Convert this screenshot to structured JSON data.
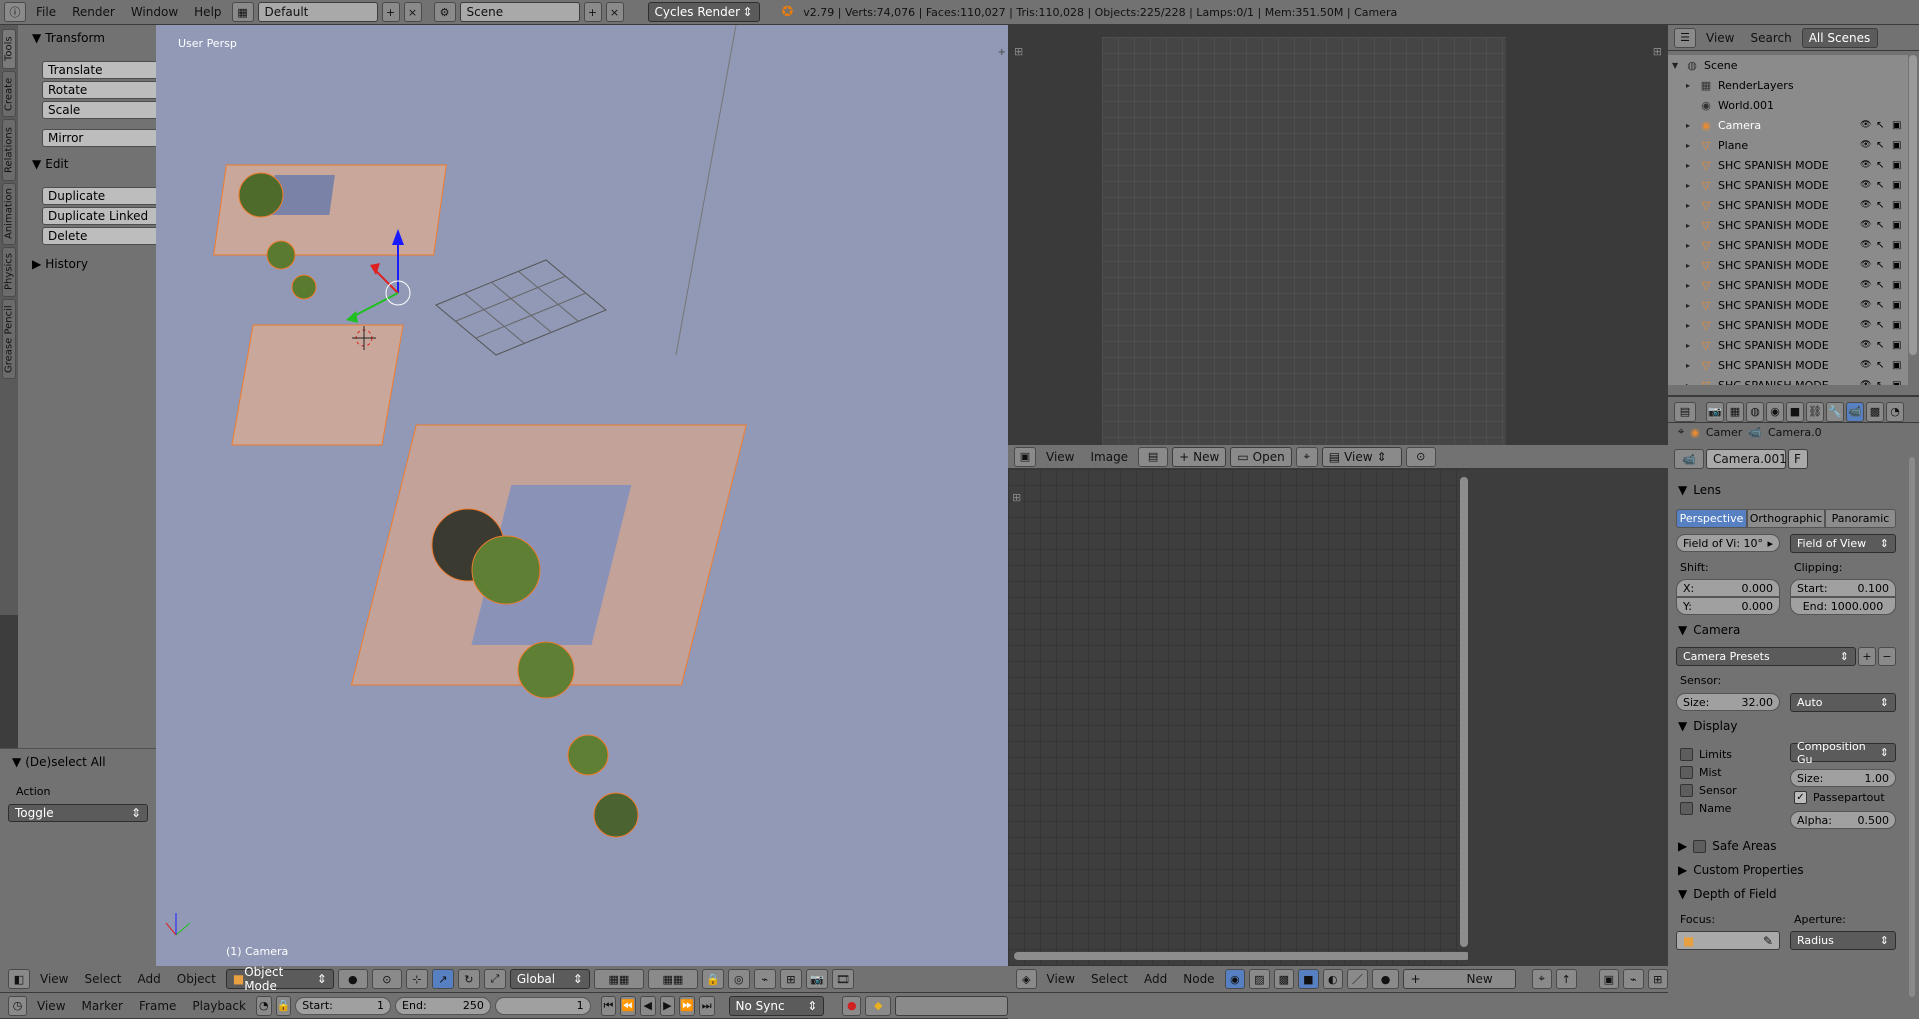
{
  "topbar": {
    "menus": [
      "File",
      "Render",
      "Window",
      "Help"
    ],
    "layout": "Default",
    "scene": "Scene",
    "engine": "Cycles Render",
    "stats": "v2.79 | Verts:74,076 | Faces:110,027 | Tris:110,028 | Objects:225/228 | Lamps:0/1 | Mem:351.50M | Camera"
  },
  "left_tabs": [
    "Tools",
    "Create",
    "Relations",
    "Animation",
    "Physics",
    "Grease Pencil"
  ],
  "toolshelf": {
    "transform_title": "Transform",
    "transform_buttons": [
      "Translate",
      "Rotate",
      "Scale"
    ],
    "mirror": "Mirror",
    "edit_title": "Edit",
    "edit_buttons": [
      "Duplicate",
      "Duplicate Linked",
      "Delete"
    ],
    "history_title": "History"
  },
  "operator": {
    "title": "(De)select All",
    "action_label": "Action",
    "action_value": "Toggle"
  },
  "viewport": {
    "label": "User Persp",
    "object_label": "(1) Camera",
    "menus": [
      "View",
      "Select",
      "Add",
      "Object"
    ],
    "mode": "Object Mode",
    "orientation": "Global"
  },
  "timeline": {
    "menus": [
      "View",
      "Marker",
      "Frame",
      "Playback"
    ],
    "start_label": "Start:",
    "start": "1",
    "end_label": "End:",
    "end": "250",
    "current": "1",
    "sync": "No Sync"
  },
  "image_editor": {
    "menus": [
      "View",
      "Image"
    ],
    "new": "New",
    "open": "Open",
    "view": "View"
  },
  "node_editor": {
    "menus": [
      "View",
      "Select",
      "Add",
      "Node"
    ],
    "new": "New"
  },
  "outliner": {
    "menus": [
      "View",
      "Search"
    ],
    "filter": "All Scenes",
    "items": [
      "Scene",
      "RenderLayers",
      "World.001",
      "Camera",
      "Plane",
      "SHC SPANISH MODERN",
      "SHC SPANISH MODERN",
      "SHC SPANISH MODERN",
      "SHC SPANISH MODERN",
      "SHC SPANISH MODERN",
      "SHC SPANISH MODERN",
      "SHC SPANISH MODERN",
      "SHC SPANISH MODERN",
      "SHC SPANISH MODERN",
      "SHC SPANISH MODERN",
      "SHC SPANISH MODERN",
      "SHC SPANISH MODERN"
    ]
  },
  "properties": {
    "breadcrumb_obj": "Camer",
    "breadcrumb_data": "Camera.0",
    "datablock": "Camera.001",
    "fake_user": "F",
    "lens_title": "Lens",
    "lens_types": [
      "Perspective",
      "Orthographic",
      "Panoramic"
    ],
    "fov_field": "Field of Vi: 10°",
    "fov_mode": "Field of View",
    "shift_label": "Shift:",
    "clipping_label": "Clipping:",
    "shift_x": "X:",
    "shift_x_val": "0.000",
    "shift_y": "Y:",
    "shift_y_val": "0.000",
    "clip_start": "Start:",
    "clip_start_val": "0.100",
    "clip_end": "End: 1000.000",
    "camera_title": "Camera",
    "camera_presets": "Camera Presets",
    "sensor_label": "Sensor:",
    "sensor_size": "Size:",
    "sensor_size_val": "32.00",
    "sensor_fit": "Auto",
    "display_title": "Display",
    "display_checks": [
      "Limits",
      "Mist",
      "Sensor",
      "Name"
    ],
    "composition": "Composition Gu",
    "display_size": "Size:",
    "display_size_val": "1.00",
    "passepartout": "Passepartout",
    "alpha": "Alpha:",
    "alpha_val": "0.500",
    "safe_areas": "Safe Areas",
    "custom_props": "Custom Properties",
    "dof_title": "Depth of Field",
    "focus": "Focus:",
    "aperture": "Aperture:",
    "aperture_mode": "Radius"
  },
  "colors": {
    "viewport_bg": "#9199b7",
    "accent": "#5680c2",
    "selection": "#f07b2c"
  }
}
